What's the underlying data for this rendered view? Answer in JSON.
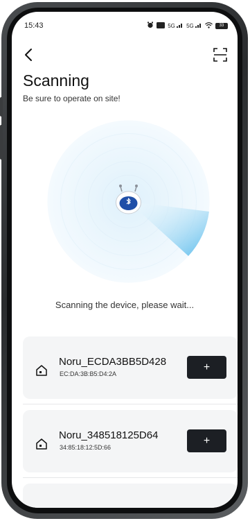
{
  "status_bar": {
    "time": "15:43",
    "icons": [
      "alarm-icon",
      "hd-icon",
      "signal-5g-icon",
      "signal-5g-icon",
      "wifi-icon",
      "battery-icon"
    ],
    "signal_1": "5G",
    "signal_2": "5G",
    "battery": "33"
  },
  "header": {
    "title": "Scanning",
    "subtitle": "Be sure to operate on site!"
  },
  "radar": {
    "status_text": "Scanning the device, please wait...",
    "accent_color": "#5bbcec",
    "robot_color": "#1f4fa8"
  },
  "devices": [
    {
      "name": "Noru_ECDA3BB5D428",
      "mac": "EC:DA:3B:B5:D4:2A",
      "action_label": "+"
    },
    {
      "name": "Noru_348518125D64",
      "mac": "34:85:18:12:5D:66",
      "action_label": "+"
    }
  ]
}
